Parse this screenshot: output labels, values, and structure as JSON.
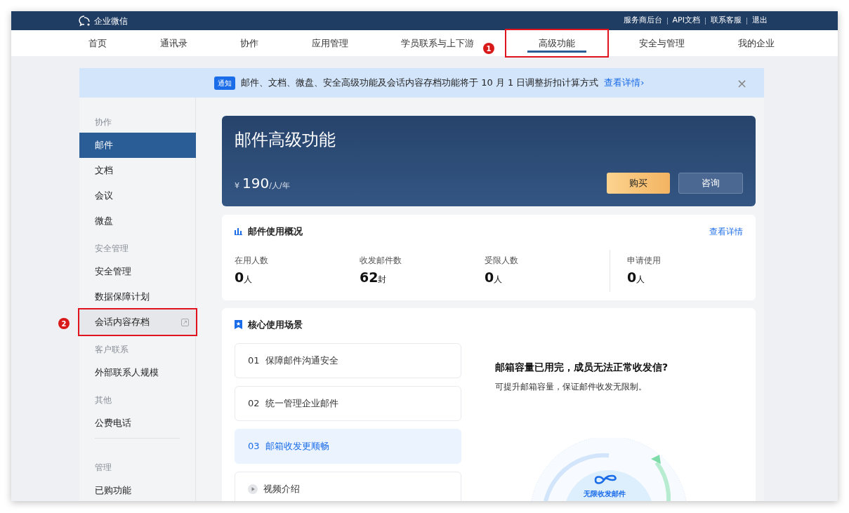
{
  "topbar": {
    "logo": "企业微信",
    "links": [
      "服务商后台",
      "API文档",
      "联系客服",
      "退出"
    ]
  },
  "nav": [
    {
      "label": "首页",
      "selected": false
    },
    {
      "label": "通讯录",
      "selected": false
    },
    {
      "label": "协作",
      "selected": false
    },
    {
      "label": "应用管理",
      "selected": false
    },
    {
      "label": "学员联系与上下游",
      "selected": false
    },
    {
      "label": "高级功能",
      "selected": true,
      "annotation": "1"
    },
    {
      "label": "安全与管理",
      "selected": false
    },
    {
      "label": "我的企业",
      "selected": false
    }
  ],
  "notice": {
    "badge": "通知",
    "text": "邮件、文档、微盘、安全高级功能及会话内容存档功能将于 10 月 1 日调整折扣计算方式",
    "link": "查看详情›",
    "close": "×"
  },
  "sidebar": [
    {
      "kind": "header",
      "label": "协作"
    },
    {
      "kind": "item",
      "label": "邮件",
      "selected": true
    },
    {
      "kind": "item",
      "label": "文档",
      "selected": false
    },
    {
      "kind": "item",
      "label": "会议",
      "selected": false
    },
    {
      "kind": "item",
      "label": "微盘",
      "selected": false
    },
    {
      "kind": "header",
      "label": "安全管理"
    },
    {
      "kind": "item",
      "label": "安全管理",
      "selected": false
    },
    {
      "kind": "item",
      "label": "数据保障计划",
      "selected": false
    },
    {
      "kind": "item",
      "label": "会话内容存档",
      "selected": false,
      "external": true,
      "annotation": "2"
    },
    {
      "kind": "header",
      "label": "客户联系"
    },
    {
      "kind": "item",
      "label": "外部联系人规模",
      "selected": false
    },
    {
      "kind": "header",
      "label": "其他"
    },
    {
      "kind": "item",
      "label": "公费电话",
      "selected": false
    },
    {
      "kind": "divider"
    },
    {
      "kind": "header",
      "label": "管理"
    },
    {
      "kind": "item",
      "label": "已购功能",
      "selected": false
    }
  ],
  "hero": {
    "title": "邮件高级功能",
    "currency": "¥",
    "price": "190",
    "unit": "/人/年",
    "buttons": [
      "购买",
      "咨询"
    ]
  },
  "usage": {
    "title": "邮件使用概况",
    "link": "查看详情",
    "stats": [
      {
        "label": "在用人数",
        "value": "0",
        "unit": "人"
      },
      {
        "label": "收发邮件数",
        "value": "62",
        "unit": "封"
      },
      {
        "label": "受限人数",
        "value": "0",
        "unit": "人"
      },
      {
        "label": "申请使用",
        "value": "0",
        "unit": "人"
      }
    ]
  },
  "scenarios": {
    "title": "核心使用场景",
    "items": [
      {
        "kind": "scenario",
        "num": "01",
        "label": "保障邮件沟通安全",
        "selected": false
      },
      {
        "kind": "scenario",
        "num": "02",
        "label": "统一管理企业邮件",
        "selected": false
      },
      {
        "kind": "scenario",
        "num": "03",
        "label": "邮箱收发更顺畅",
        "selected": true
      },
      {
        "kind": "video",
        "label": "视频介绍"
      }
    ],
    "detail": {
      "title": "邮箱容量已用完，成员无法正常收发信?",
      "text": "可提升邮箱容量，保证邮件收发无限制。",
      "illustration": "无限收发邮件"
    }
  }
}
